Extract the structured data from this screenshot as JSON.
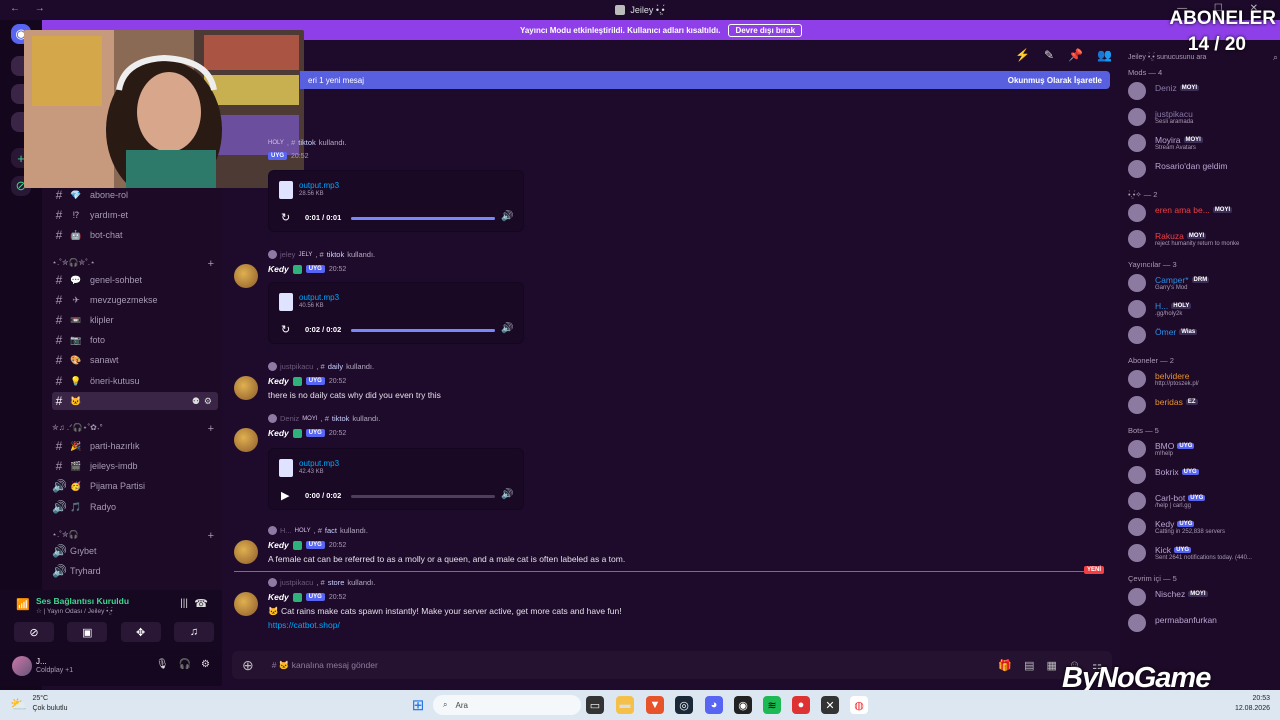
{
  "window": {
    "title": "Jeiley •̀.̫•́"
  },
  "streamer_banner": {
    "text": "Yayıncı Modu etkinleştirildi. Kullanıcı adları kısaltıldı.",
    "button": "Devre dışı bırak"
  },
  "overlay": {
    "label": "ABONELER",
    "count": "14 / 20",
    "watermark": "ByNoGame"
  },
  "new_messages_bar": {
    "text": "eri 1 yeni mesaj",
    "action": "Okunmuş Olarak İşaretle"
  },
  "sidebar": {
    "channels_top": [
      {
        "emoji": "💎",
        "name": "abone-rol"
      },
      {
        "emoji": "⁉",
        "name": "yardım-et"
      },
      {
        "emoji": "🤖",
        "name": "bot-chat"
      }
    ],
    "category1": "⋆.˚✮🎧✮˚.⋆",
    "channels_chat": [
      {
        "emoji": "💬",
        "name": "genel-sohbet"
      },
      {
        "emoji": "✈",
        "name": "mevzugezmekse"
      },
      {
        "emoji": "📼",
        "name": "klipler"
      },
      {
        "emoji": "📷",
        "name": "foto"
      },
      {
        "emoji": "🎨",
        "name": "sanawt"
      },
      {
        "emoji": "💡",
        "name": "öneri-kutusu"
      },
      {
        "emoji": "🐱",
        "name": ""
      }
    ],
    "category2": "✮♫ .ᐟ🎧⋆˚✿˖°",
    "channels_voice": [
      {
        "type": "text",
        "emoji": "🎉",
        "name": "parti-hazırlık"
      },
      {
        "type": "text",
        "emoji": "🎬",
        "name": "jeileys-imdb"
      },
      {
        "type": "voice",
        "emoji": "🥳",
        "name": "Pijama Partisi"
      },
      {
        "type": "voice",
        "emoji": "🎵",
        "name": "Radyo"
      }
    ],
    "category3": "⋆.˚✮🎧",
    "channels_extra": [
      {
        "name": "Gıybet"
      },
      {
        "name": "Tryhard"
      }
    ]
  },
  "voice_panel": {
    "status": "Ses Bağlantısı Kuruldu",
    "sub": "☆ | Yayın Odası / Jeiley •̀.̫•́"
  },
  "user_panel": {
    "name": "J...",
    "status": "Coldplay +1"
  },
  "messages": [
    {
      "reply_user": "",
      "reply_tag": "HOLY",
      "reply_cmd": "tiktok",
      "reply_suffix": "kullandı.",
      "author": "",
      "badge": "UYG",
      "time": "20:52",
      "file": "output.mp3",
      "size": "28.56 KB",
      "atime": "0:01 / 0:01",
      "progress": 1.0
    },
    {
      "reply_user": "jeley",
      "reply_tag": "JELY",
      "reply_cmd": "tiktok",
      "reply_suffix": "kullandı.",
      "author": "Kedy",
      "badge": "UYG",
      "time": "20:52",
      "file": "output.mp3",
      "size": "40.56 KB",
      "atime": "0:02 / 0:02",
      "progress": 1.0
    },
    {
      "reply_user": "justpikacu",
      "reply_tag": "",
      "reply_cmd": "daily",
      "reply_suffix": "kullandı.",
      "author": "Kedy",
      "badge": "UYG",
      "time": "20:52",
      "text": "there is no daily cats why did you even try this"
    },
    {
      "reply_user": "Deniz",
      "reply_tag": "MOYI",
      "reply_cmd": "tiktok",
      "reply_suffix": "kullandı.",
      "author": "Kedy",
      "badge": "UYG",
      "time": "20:52",
      "file": "output.mp3",
      "size": "42.43 KB",
      "atime": "0:00 / 0:02",
      "progress": 0.0
    },
    {
      "reply_user": "H...",
      "reply_tag": "HOLY",
      "reply_cmd": "fact",
      "reply_suffix": "kullandı.",
      "author": "Kedy",
      "badge": "UYG",
      "time": "20:52",
      "text": "A female cat can be referred to as a molly or a queen, and a male cat is often labeled as a tom."
    },
    {
      "reply_user": "justpikacu",
      "reply_tag": "",
      "reply_cmd": "store",
      "reply_suffix": "kullandı.",
      "author": "Kedy",
      "badge": "UYG",
      "time": "20:52",
      "text": "Cat rains make cats spawn instantly! Make your server active, get more cats and have fun!",
      "link": "https://catbot.shop/"
    }
  ],
  "new_marker": "YENİ",
  "composer": {
    "placeholder": "# 🐱 kanalına mesaj gönder"
  },
  "members": {
    "search": "Jeiley •̀.̫•́ sunucusunu ara",
    "groups": [
      {
        "title": "Mods — 4",
        "members": [
          {
            "name": "Deniz",
            "tag": "MOYI",
            "status": "",
            "color": "#8a7aa6"
          },
          {
            "name": "justpikacu",
            "tag": "",
            "status": "Sesli aramada",
            "color": "#8a7aa6"
          },
          {
            "name": "Moyira",
            "tag": "MOYI",
            "status": "Stream Avatars",
            "color": "#b9a6d0"
          },
          {
            "name": "Rosario'dan geldim",
            "tag": "",
            "status": "",
            "color": "#b9a6d0"
          }
        ]
      },
      {
        "title": "•̀.̫•́✧ — 2",
        "members": [
          {
            "name": "eren ama be...",
            "tag": "MOYI",
            "status": "",
            "color": "#f23f43"
          },
          {
            "name": "Rakuza",
            "tag": "MOYI",
            "status": "reject humanity return to monke",
            "color": "#f23f43"
          }
        ]
      },
      {
        "title": "Yayıncılar — 3",
        "members": [
          {
            "name": "Camper*",
            "tag": "DRM",
            "status": "Garry's Mod",
            "color": "#2b8fe8"
          },
          {
            "name": "H...",
            "tag": "HOLY",
            "status": ".gg/holy2k",
            "color": "#2b8fe8"
          },
          {
            "name": "Ömer",
            "tag": "Wias",
            "status": "",
            "color": "#2b8fe8"
          }
        ]
      },
      {
        "title": "Aboneler — 2",
        "members": [
          {
            "name": "belvidere",
            "tag": "",
            "status": "http://ptoszek.pl/",
            "color": "#e8932b"
          },
          {
            "name": "beridas",
            "tag": "EZ",
            "status": "",
            "color": "#e8932b"
          }
        ]
      },
      {
        "title": "Bots — 5",
        "members": [
          {
            "name": "BMO",
            "tag": "UYG",
            "status": "m!help",
            "color": "#b9a6d0"
          },
          {
            "name": "Bokrix",
            "tag": "UYG",
            "status": "",
            "color": "#b9a6d0"
          },
          {
            "name": "Carl-bot",
            "tag": "UYG",
            "status": "/help | carl.gg",
            "color": "#b9a6d0"
          },
          {
            "name": "Kedy",
            "tag": "UYG",
            "status": "Catting in 252,838 servers",
            "color": "#b9a6d0"
          },
          {
            "name": "Kick",
            "tag": "UYG",
            "status": "Sent 2641 notifications today. (440...",
            "color": "#b9a6d0"
          }
        ]
      },
      {
        "title": "Çevrim içi — 5",
        "members": [
          {
            "name": "Nischez",
            "tag": "MOYI",
            "status": "",
            "color": "#b9a6d0"
          },
          {
            "name": "permabanfurkan",
            "tag": "",
            "status": "",
            "color": "#b9a6d0"
          }
        ]
      }
    ]
  },
  "taskbar": {
    "temp": "25°C",
    "weather": "Çok bulutlu",
    "search": "Ara",
    "time": "20:53",
    "date": "12.08.2026"
  },
  "colors": {
    "accent": "#5865f2",
    "banner": "#8e3fe8",
    "background": "#1e0b2b"
  }
}
